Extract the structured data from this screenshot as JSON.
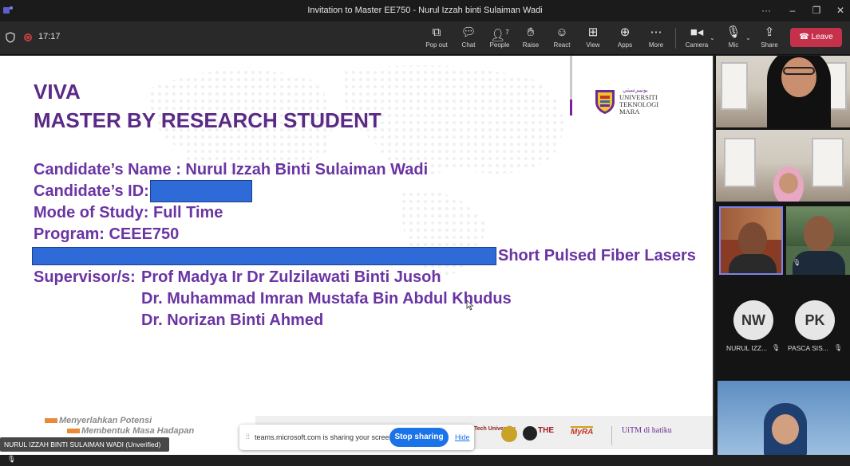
{
  "window": {
    "title": "Invitation to Master EE750 - Nurul Izzah binti Sulaiman Wadi",
    "controls": [
      "···",
      "–",
      "❐",
      "✕"
    ]
  },
  "toolbar": {
    "timer": "17:17",
    "buttons": [
      {
        "label": "Pop out",
        "icon": "pop-out-icon"
      },
      {
        "label": "Chat",
        "icon": "chat-icon"
      },
      {
        "label": "People",
        "icon": "people-icon",
        "count": "7"
      },
      {
        "label": "Raise",
        "icon": "hand-icon"
      },
      {
        "label": "React",
        "icon": "smile-icon"
      },
      {
        "label": "View",
        "icon": "grid-icon"
      },
      {
        "label": "Apps",
        "icon": "apps-icon"
      },
      {
        "label": "More",
        "icon": "more-icon"
      }
    ],
    "camera_label": "Camera",
    "mic_label": "Mic",
    "share_label": "Share",
    "leave_label": "Leave",
    "leave_color": "#c4314b"
  },
  "slide": {
    "heading_line1": "VIVA",
    "heading_line2": "MASTER BY RESEARCH STUDENT",
    "candidate_name": "Candidate’s Name : Nurul Izzah Binti Sulaiman Wadi",
    "candidate_id_label": "Candidate’s ID:",
    "mode": "Mode of Study: Full Time",
    "program": "Program: CEEE750",
    "title_tail": "Short Pulsed Fiber Lasers",
    "supervisor_label": "Supervisor/s:",
    "supervisors": [
      "Prof Madya Ir Dr Zulzilawati Binti Jusoh",
      "Dr. Muhammad Imran Mustafa Bin Abdul Khudus",
      "Dr. Norizan Binti Ahmed"
    ],
    "logo_lines": [
      "UNIVERSITI",
      "TEKNOLOGI",
      "MARA"
    ],
    "tagline": [
      "Menyerlahkan Potensi",
      "Membentuk Masa Hadapan"
    ],
    "footer_logos": [
      "Tech University",
      "THE",
      "MyRA",
      "UiTM di hatiku"
    ],
    "accent_color": "#6a34a3"
  },
  "share_notice": {
    "message": "teams.microsoft.com is sharing your screen.",
    "stop_label": "Stop sharing",
    "hide_label": "Hide"
  },
  "presenter_tag": "NURUL IZZAH BINTI SULAIMAN WADI (Unverified)",
  "participants": {
    "avatars": [
      {
        "initials": "NW",
        "name": "NURUL IZZ..."
      },
      {
        "initials": "PK",
        "name": "PASCA SIS..."
      }
    ]
  }
}
